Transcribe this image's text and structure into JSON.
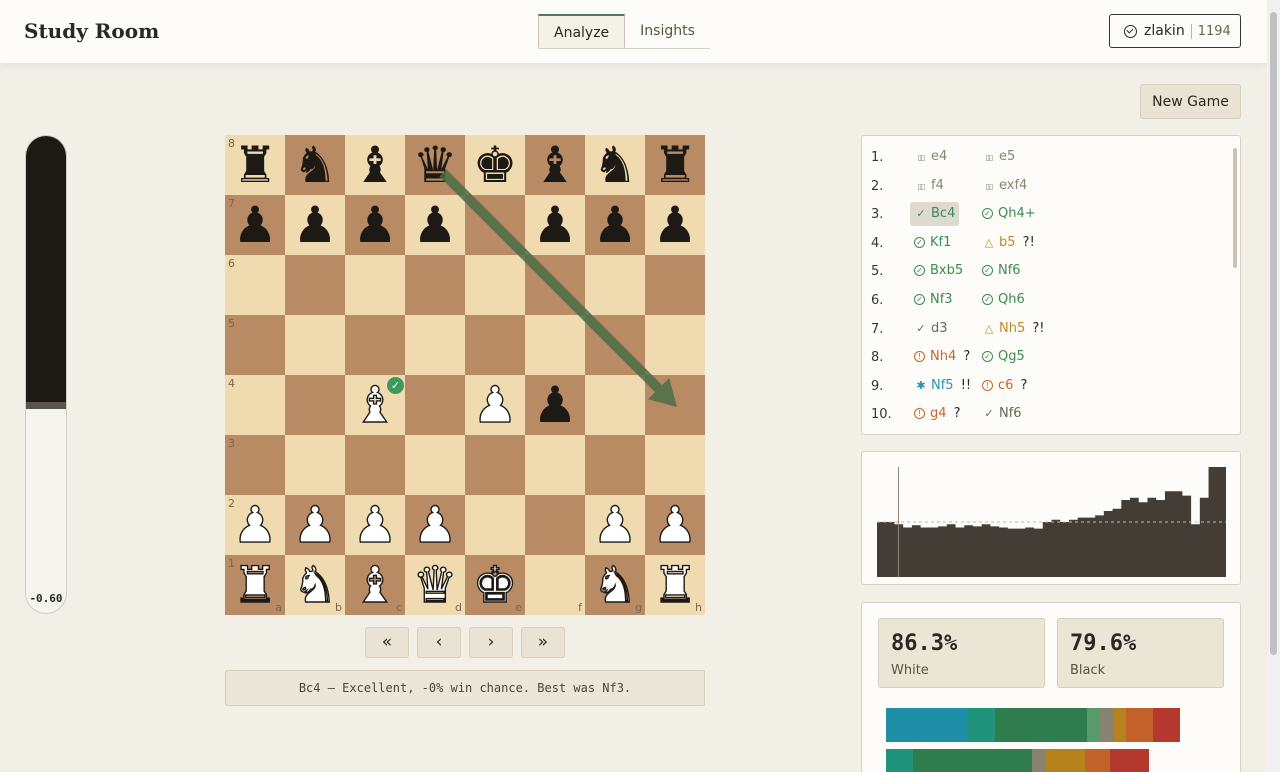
{
  "app": {
    "title": "Study Room"
  },
  "tabs": [
    {
      "label": "Analyze",
      "active": true
    },
    {
      "label": "Insights",
      "active": false
    }
  ],
  "user": {
    "name": "zlakin",
    "rating": "1194"
  },
  "new_game_label": "New Game",
  "eval": {
    "value": "-0.60",
    "black_fraction": 0.57
  },
  "board": {
    "files": [
      "a",
      "b",
      "c",
      "d",
      "e",
      "f",
      "g",
      "h"
    ],
    "ranks": [
      "8",
      "7",
      "6",
      "5",
      "4",
      "3",
      "2",
      "1"
    ],
    "pieces": [
      {
        "sq": "a8",
        "p": "♜",
        "c": "b"
      },
      {
        "sq": "b8",
        "p": "♞",
        "c": "b"
      },
      {
        "sq": "c8",
        "p": "♝",
        "c": "b"
      },
      {
        "sq": "d8",
        "p": "♛",
        "c": "b"
      },
      {
        "sq": "e8",
        "p": "♚",
        "c": "b"
      },
      {
        "sq": "f8",
        "p": "♝",
        "c": "b"
      },
      {
        "sq": "g8",
        "p": "♞",
        "c": "b"
      },
      {
        "sq": "h8",
        "p": "♜",
        "c": "b"
      },
      {
        "sq": "a7",
        "p": "♟",
        "c": "b"
      },
      {
        "sq": "b7",
        "p": "♟",
        "c": "b"
      },
      {
        "sq": "c7",
        "p": "♟",
        "c": "b"
      },
      {
        "sq": "d7",
        "p": "♟",
        "c": "b"
      },
      {
        "sq": "f7",
        "p": "♟",
        "c": "b"
      },
      {
        "sq": "g7",
        "p": "♟",
        "c": "b"
      },
      {
        "sq": "h7",
        "p": "♟",
        "c": "b"
      },
      {
        "sq": "c4",
        "p": "♝",
        "c": "w"
      },
      {
        "sq": "e4",
        "p": "♟",
        "c": "w"
      },
      {
        "sq": "f4",
        "p": "♟",
        "c": "b"
      },
      {
        "sq": "a2",
        "p": "♟",
        "c": "w"
      },
      {
        "sq": "b2",
        "p": "♟",
        "c": "w"
      },
      {
        "sq": "c2",
        "p": "♟",
        "c": "w"
      },
      {
        "sq": "d2",
        "p": "♟",
        "c": "w"
      },
      {
        "sq": "g2",
        "p": "♟",
        "c": "w"
      },
      {
        "sq": "h2",
        "p": "♟",
        "c": "w"
      },
      {
        "sq": "a1",
        "p": "♜",
        "c": "w"
      },
      {
        "sq": "b1",
        "p": "♞",
        "c": "w"
      },
      {
        "sq": "c1",
        "p": "♝",
        "c": "w"
      },
      {
        "sq": "d1",
        "p": "♛",
        "c": "w"
      },
      {
        "sq": "e1",
        "p": "♚",
        "c": "w"
      },
      {
        "sq": "g1",
        "p": "♞",
        "c": "w"
      },
      {
        "sq": "h1",
        "p": "♜",
        "c": "w"
      }
    ],
    "badge_square": "c4",
    "arrow": {
      "from": "d8",
      "to": "h4",
      "color": "#4a6d45"
    }
  },
  "nav": {
    "first": "«",
    "prev": "‹",
    "next": "›",
    "last": "»"
  },
  "comment": "Bc4 — Excellent, -0% win chance. Best was Nf3.",
  "colors": {
    "book": "#8a8478",
    "best": "#3d8a57",
    "good": "#5a6e58",
    "inacc": "#c08a2a",
    "mistake": "#c2662e",
    "brilliant": "#2a93b5"
  },
  "moves": [
    {
      "num": "1.",
      "w": {
        "san": "e4",
        "cls": "book",
        "icon": "book-icon"
      },
      "b": {
        "san": "e5",
        "cls": "book",
        "icon": "book-icon"
      }
    },
    {
      "num": "2.",
      "w": {
        "san": "f4",
        "cls": "book",
        "icon": "book-icon"
      },
      "b": {
        "san": "exf4",
        "cls": "book",
        "icon": "book-icon"
      }
    },
    {
      "num": "3.",
      "w": {
        "san": "Bc4",
        "cls": "best",
        "icon": "check-icon",
        "sel": true
      },
      "b": {
        "san": "Qh4+",
        "cls": "best",
        "icon": "circle-check-icon"
      }
    },
    {
      "num": "4.",
      "w": {
        "san": "Kf1",
        "cls": "best",
        "icon": "circle-check-icon"
      },
      "b": {
        "san": "b5",
        "cls": "inacc",
        "icon": "warning-icon",
        "ann": "?!"
      }
    },
    {
      "num": "5.",
      "w": {
        "san": "Bxb5",
        "cls": "best",
        "icon": "circle-check-icon"
      },
      "b": {
        "san": "Nf6",
        "cls": "best",
        "icon": "circle-check-icon"
      }
    },
    {
      "num": "6.",
      "w": {
        "san": "Nf3",
        "cls": "best",
        "icon": "circle-check-icon"
      },
      "b": {
        "san": "Qh6",
        "cls": "best",
        "icon": "circle-check-icon"
      }
    },
    {
      "num": "7.",
      "w": {
        "san": "d3",
        "cls": "good",
        "icon": "check-icon"
      },
      "b": {
        "san": "Nh5",
        "cls": "inacc",
        "icon": "warning-icon",
        "ann": "?!"
      }
    },
    {
      "num": "8.",
      "w": {
        "san": "Nh4",
        "cls": "mistake",
        "icon": "circle-alert-icon",
        "ann": "?"
      },
      "b": {
        "san": "Qg5",
        "cls": "best",
        "icon": "circle-check-icon"
      }
    },
    {
      "num": "9.",
      "w": {
        "san": "Nf5",
        "cls": "brilliant",
        "icon": "sparkle-icon",
        "ann": "!!"
      },
      "b": {
        "san": "c6",
        "cls": "mistake",
        "icon": "circle-alert-icon",
        "ann": "?"
      }
    },
    {
      "num": "10.",
      "w": {
        "san": "g4",
        "cls": "mistake",
        "icon": "circle-alert-icon",
        "ann": "?"
      },
      "b": {
        "san": "Nf6",
        "cls": "good",
        "icon": "check-icon"
      }
    }
  ],
  "eval_graph": {
    "values": [
      0.5,
      0.5,
      0.48,
      0.45,
      0.47,
      0.45,
      0.45,
      0.46,
      0.48,
      0.45,
      0.47,
      0.46,
      0.48,
      0.46,
      0.45,
      0.44,
      0.44,
      0.45,
      0.44,
      0.5,
      0.52,
      0.5,
      0.52,
      0.54,
      0.54,
      0.56,
      0.6,
      0.62,
      0.7,
      0.72,
      0.68,
      0.72,
      0.7,
      0.78,
      0.78,
      0.74,
      0.48,
      0.72,
      1.0,
      1.0
    ],
    "current_index": 3
  },
  "stats": {
    "white": {
      "pct": "86.3%",
      "label": "White"
    },
    "black": {
      "pct": "79.6%",
      "label": "Black"
    }
  },
  "accuracy_bars": [
    [
      {
        "w": 0.24,
        "color": "#1f8fa8"
      },
      {
        "w": 0.08,
        "color": "#20947a"
      },
      {
        "w": 0.27,
        "color": "#2f7d4e"
      },
      {
        "w": 0.04,
        "color": "#5a9a6a"
      },
      {
        "w": 0.04,
        "color": "#8a8270"
      },
      {
        "w": 0.035,
        "color": "#b5821e"
      },
      {
        "w": 0.08,
        "color": "#c2622a"
      },
      {
        "w": 0.08,
        "color": "#b5382f"
      }
    ],
    [
      {
        "w": 0.08,
        "color": "#20947a"
      },
      {
        "w": 0.35,
        "color": "#2f7d4e"
      },
      {
        "w": 0.04,
        "color": "#8a8270"
      },
      {
        "w": 0.115,
        "color": "#b5821e"
      },
      {
        "w": 0.075,
        "color": "#c2622a"
      },
      {
        "w": 0.115,
        "color": "#b5382f"
      }
    ]
  ]
}
